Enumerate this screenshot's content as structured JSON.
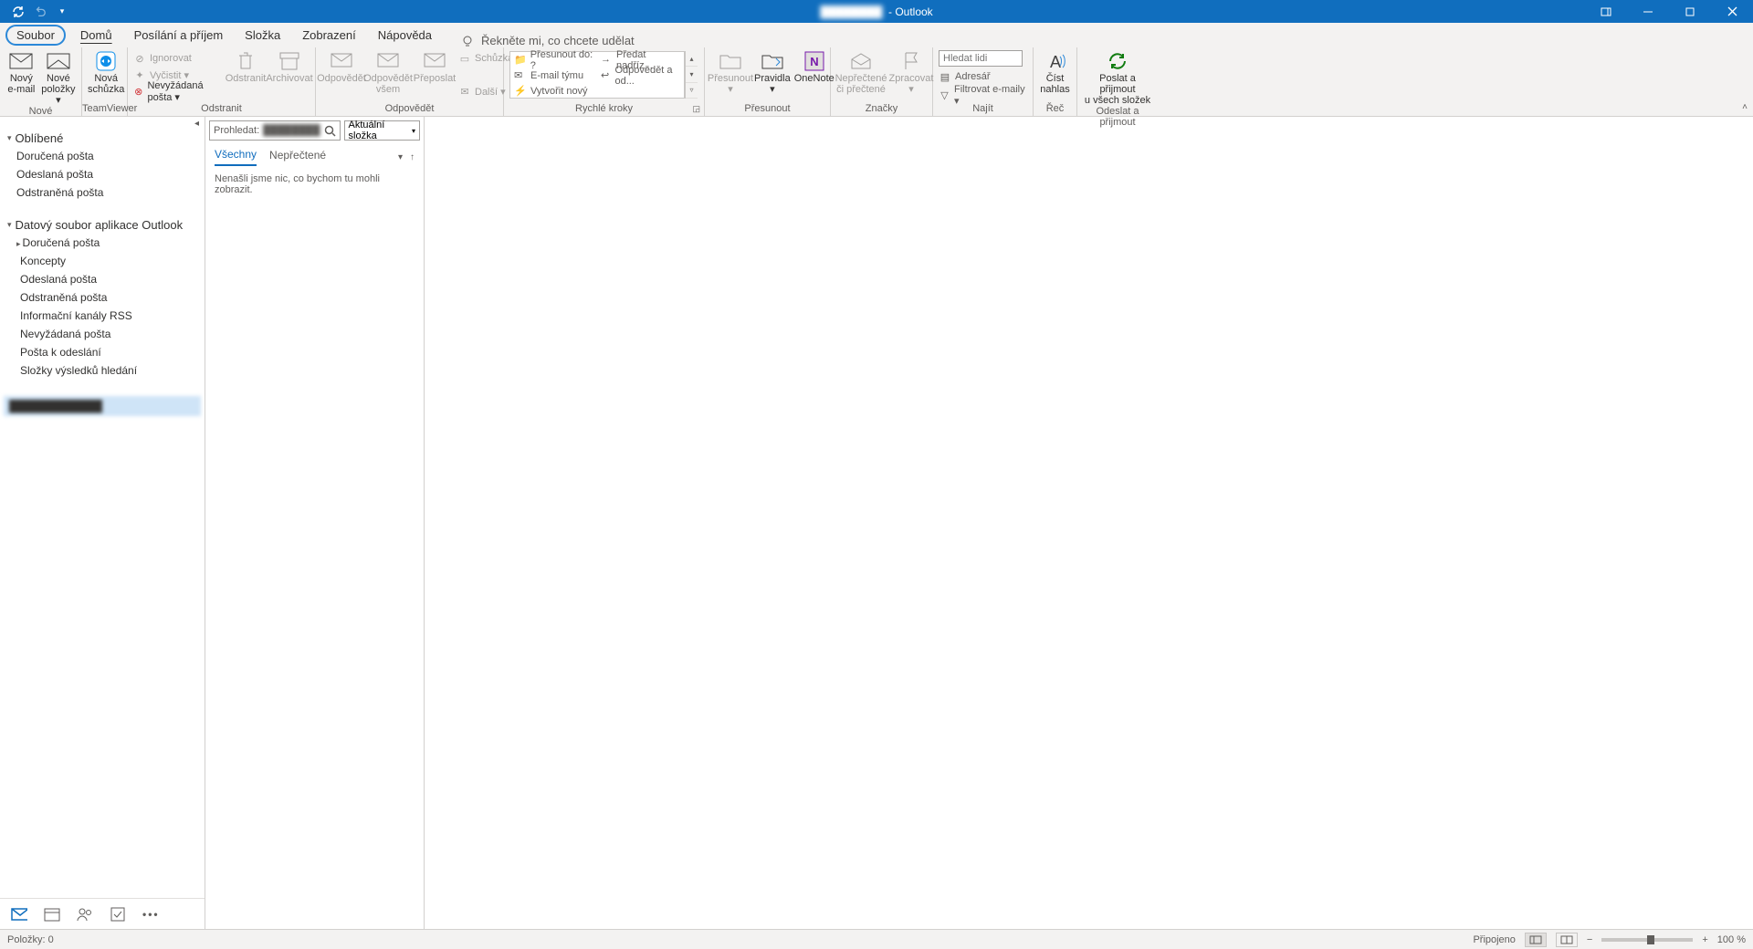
{
  "title_suffix": "- Outlook",
  "tabs": {
    "file": "Soubor",
    "home": "Domů",
    "sendreceive": "Posílání a příjem",
    "folder": "Složka",
    "view": "Zobrazení",
    "help": "Nápověda",
    "tellme": "Řekněte mi, co chcete udělat"
  },
  "ribbon": {
    "new": {
      "label": "Nové",
      "new_email": "Nový\ne-mail",
      "new_items": "Nové\npoložky ▾",
      "teamviewer_label": "TeamViewer",
      "teamviewer_btn": "Nová\nschůzka"
    },
    "delete": {
      "label": "Odstranit",
      "ignore": "Ignorovat",
      "cleanup": "Vyčistit ▾",
      "junk": "Nevyžádaná pošta ▾",
      "delete_btn": "Odstranit",
      "archive": "Archivovat"
    },
    "respond": {
      "label": "Odpovědět",
      "reply": "Odpovědět",
      "reply_all": "Odpovědět\nvšem",
      "forward": "Přeposlat",
      "meeting": "Schůzka",
      "more": "Další ▾"
    },
    "quicksteps": {
      "label": "Rychlé kroky",
      "items": [
        "Přesunout do: ?",
        "E-mail týmu",
        "Vytvořit nový"
      ],
      "items_right": [
        "Předat nadříz...",
        "Odpovědět a od..."
      ]
    },
    "move": {
      "label": "Přesunout",
      "move_btn": "Přesunout",
      "rules": "Pravidla",
      "onenote": "OneNote"
    },
    "tags": {
      "label": "Značky",
      "unread": "Nepřečtené\nči přečtené",
      "categorize": "Zpracovat"
    },
    "find": {
      "label": "Najít",
      "search_placeholder": "Hledat lidi",
      "address_book": "Adresář",
      "filter": "Filtrovat e-maily ▾"
    },
    "speech": {
      "label": "Řeč",
      "read_aloud": "Číst\nnahlas"
    },
    "sendreceive_grp": {
      "label": "Odeslat a přijmout",
      "btn": "Poslat a přijmout\nu všech složek"
    }
  },
  "folder_pane": {
    "favorites": "Oblíbené",
    "fav_items": [
      "Doručená pošta",
      "Odeslaná pošta",
      "Odstraněná pošta"
    ],
    "data_file": "Datový soubor aplikace Outlook",
    "df_items": [
      "Doručená pošta",
      "Koncepty",
      "Odeslaná pošta",
      "Odstraněná pošta",
      "Informační kanály RSS",
      "Nevyžádaná pošta",
      "Pošta k odeslání",
      "Složky výsledků hledání"
    ],
    "account_blurred": "████████████"
  },
  "message_list": {
    "search_label": "Prohledat:",
    "scope": "Aktuální složka",
    "filter_all": "Všechny",
    "filter_unread": "Nepřečtené",
    "empty": "Nenašli jsme nic, co bychom tu mohli zobrazit."
  },
  "statusbar": {
    "items": "Položky: 0",
    "connected": "Připojeno",
    "zoom": "100 %"
  }
}
